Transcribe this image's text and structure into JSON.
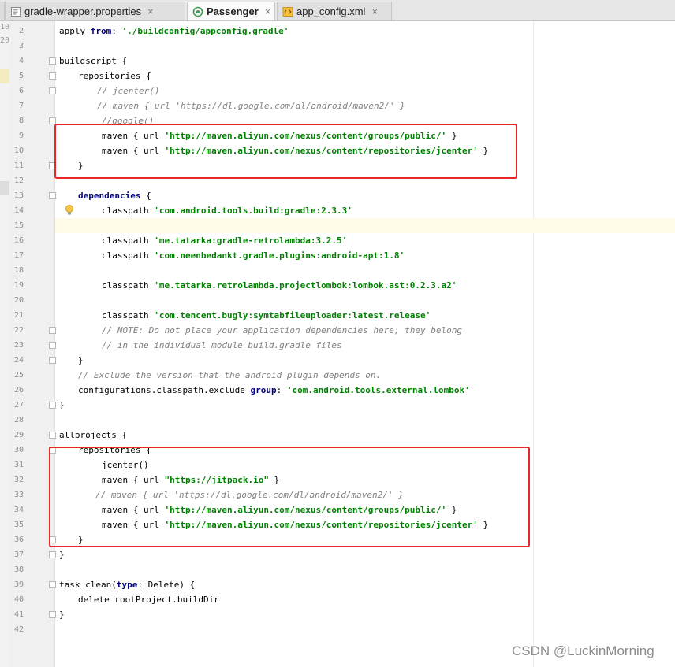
{
  "tabs": [
    {
      "label": "gradle-wrapper.properties",
      "close": "×",
      "active": false
    },
    {
      "label": "Passenger",
      "close": "×",
      "active": true
    },
    {
      "label": "app_config.xml",
      "close": "×",
      "active": false
    }
  ],
  "clipped_gutter": [
    "10",
    "20"
  ],
  "editor": {
    "lines": [
      {
        "n": "2",
        "indent": 0,
        "segs": [
          [
            "p",
            "apply "
          ],
          [
            "kw",
            "from"
          ],
          [
            "p",
            ": "
          ],
          [
            "str",
            "'./buildconfig/appconfig.gradle'"
          ]
        ]
      },
      {
        "n": "3",
        "indent": 0,
        "segs": []
      },
      {
        "n": "4",
        "indent": 0,
        "segs": [
          [
            "p",
            "buildscript {"
          ]
        ]
      },
      {
        "n": "5",
        "indent": 1,
        "segs": [
          [
            "p",
            "repositories {"
          ]
        ]
      },
      {
        "n": "6",
        "indent": 2,
        "segs": [
          [
            "cm",
            "// jcenter()"
          ]
        ]
      },
      {
        "n": "7",
        "indent": 2,
        "segs": [
          [
            "cm",
            "// maven { url 'https://dl.google.com/dl/android/maven2/' }"
          ]
        ]
      },
      {
        "n": "8",
        "indent": 2,
        "extra": 6,
        "segs": [
          [
            "cm",
            "//google()"
          ]
        ]
      },
      {
        "n": "9",
        "indent": 2,
        "extra": 6,
        "segs": [
          [
            "p",
            "maven { url "
          ],
          [
            "str",
            "'http://maven.aliyun.com/nexus/content/groups/public/'"
          ],
          [
            "p",
            " }"
          ]
        ]
      },
      {
        "n": "10",
        "indent": 2,
        "extra": 6,
        "segs": [
          [
            "p",
            "maven { url "
          ],
          [
            "str",
            "'http://maven.aliyun.com/nexus/content/repositories/jcenter'"
          ],
          [
            "p",
            " }"
          ]
        ]
      },
      {
        "n": "11",
        "indent": 1,
        "segs": [
          [
            "p",
            "}"
          ]
        ]
      },
      {
        "n": "12",
        "indent": 0,
        "segs": []
      },
      {
        "n": "13",
        "indent": 1,
        "segs": [
          [
            "kw",
            "dependencies"
          ],
          [
            "p",
            " {"
          ]
        ]
      },
      {
        "n": "14",
        "indent": 2,
        "extra": 6,
        "segs": [
          [
            "p",
            "classpath "
          ],
          [
            "str",
            "'com.android.tools.build:gradle:2.3.3'"
          ]
        ]
      },
      {
        "n": "15",
        "indent": 0,
        "segs": []
      },
      {
        "n": "16",
        "indent": 2,
        "extra": 6,
        "segs": [
          [
            "p",
            "classpath "
          ],
          [
            "str",
            "'me.tatarka:gradle-retrolambda:3.2.5'"
          ]
        ]
      },
      {
        "n": "17",
        "indent": 2,
        "extra": 6,
        "segs": [
          [
            "p",
            "classpath "
          ],
          [
            "str",
            "'com.neenbedankt.gradle.plugins:android-apt:1.8'"
          ]
        ]
      },
      {
        "n": "18",
        "indent": 0,
        "segs": []
      },
      {
        "n": "19",
        "indent": 2,
        "extra": 6,
        "segs": [
          [
            "p",
            "classpath "
          ],
          [
            "str",
            "'me.tatarka.retrolambda.projectlombok:lombok.ast:0.2.3.a2'"
          ]
        ]
      },
      {
        "n": "20",
        "indent": 0,
        "segs": []
      },
      {
        "n": "21",
        "indent": 2,
        "extra": 6,
        "segs": [
          [
            "p",
            "classpath "
          ],
          [
            "str",
            "'com.tencent.bugly:symtabfileuploader:latest.release'"
          ]
        ]
      },
      {
        "n": "22",
        "indent": 2,
        "extra": 6,
        "segs": [
          [
            "cm",
            "// NOTE: Do not place your application dependencies here; they belong"
          ]
        ]
      },
      {
        "n": "23",
        "indent": 2,
        "extra": 6,
        "segs": [
          [
            "cm",
            "// in the individual module build.gradle files"
          ]
        ]
      },
      {
        "n": "24",
        "indent": 1,
        "segs": [
          [
            "p",
            "}"
          ]
        ]
      },
      {
        "n": "25",
        "indent": 1,
        "segs": [
          [
            "cm",
            "// Exclude the version that the android plugin depends on."
          ]
        ]
      },
      {
        "n": "26",
        "indent": 1,
        "segs": [
          [
            "p",
            "configurations.classpath.exclude "
          ],
          [
            "kw",
            "group"
          ],
          [
            "p",
            ": "
          ],
          [
            "str",
            "'com.android.tools.external.lombok'"
          ]
        ]
      },
      {
        "n": "27",
        "indent": 0,
        "segs": [
          [
            "p",
            "}"
          ]
        ]
      },
      {
        "n": "28",
        "indent": 0,
        "segs": []
      },
      {
        "n": "29",
        "indent": 0,
        "segs": [
          [
            "p",
            "allprojects {"
          ]
        ]
      },
      {
        "n": "30",
        "indent": 1,
        "segs": [
          [
            "p",
            "repositories {"
          ]
        ]
      },
      {
        "n": "31",
        "indent": 2,
        "extra": 6,
        "segs": [
          [
            "p",
            "jcenter()"
          ]
        ]
      },
      {
        "n": "32",
        "indent": 2,
        "extra": 6,
        "segs": [
          [
            "p",
            "maven { url "
          ],
          [
            "str",
            "\"https://jitpack.io\""
          ],
          [
            "p",
            " }"
          ]
        ]
      },
      {
        "n": "33",
        "indent": 2,
        "extra": -2,
        "segs": [
          [
            "cm",
            "// maven { url 'https://dl.google.com/dl/android/maven2/' }"
          ]
        ]
      },
      {
        "n": "34",
        "indent": 2,
        "extra": 6,
        "segs": [
          [
            "p",
            "maven { url "
          ],
          [
            "str",
            "'http://maven.aliyun.com/nexus/content/groups/public/'"
          ],
          [
            "p",
            " }"
          ]
        ]
      },
      {
        "n": "35",
        "indent": 2,
        "extra": 6,
        "segs": [
          [
            "p",
            "maven { url "
          ],
          [
            "str",
            "'http://maven.aliyun.com/nexus/content/repositories/jcenter'"
          ],
          [
            "p",
            " }"
          ]
        ]
      },
      {
        "n": "36",
        "indent": 1,
        "segs": [
          [
            "p",
            "}"
          ]
        ]
      },
      {
        "n": "37",
        "indent": 0,
        "segs": [
          [
            "p",
            "}"
          ]
        ]
      },
      {
        "n": "38",
        "indent": 0,
        "segs": []
      },
      {
        "n": "39",
        "indent": 0,
        "segs": [
          [
            "p",
            "task clean("
          ],
          [
            "kw",
            "type"
          ],
          [
            "p",
            ": Delete) {"
          ]
        ]
      },
      {
        "n": "40",
        "indent": 1,
        "segs": [
          [
            "p",
            "delete rootProject.buildDir"
          ]
        ]
      },
      {
        "n": "41",
        "indent": 0,
        "segs": [
          [
            "p",
            "}"
          ]
        ]
      },
      {
        "n": "42",
        "indent": 0,
        "segs": []
      }
    ]
  },
  "watermark": "CSDN @LuckinMorning",
  "colors": {
    "keyword": "#000080",
    "string": "#008000",
    "comment": "#808080",
    "highlight_box": "#e8262a",
    "caret_line": "#fffbe6"
  }
}
